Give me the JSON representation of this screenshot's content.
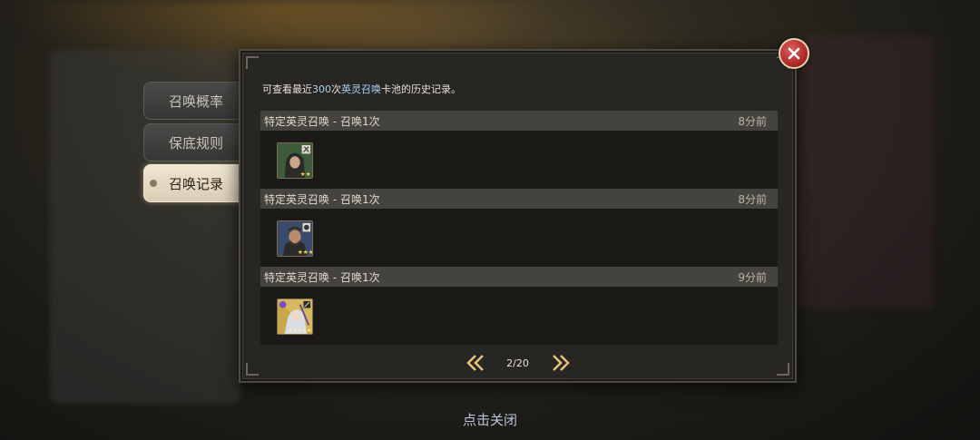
{
  "side_tabs": [
    {
      "label": "召唤概率",
      "active": false
    },
    {
      "label": "保底规则",
      "active": false
    },
    {
      "label": "召唤记录",
      "active": true
    }
  ],
  "description": {
    "prefix": "可查看最近",
    "count": "300",
    "middle": "次",
    "pool_name": "英灵召唤",
    "suffix": "卡池的历史记录。"
  },
  "records": [
    {
      "title": "特定英灵召唤 - 召唤1次",
      "time": "8分前",
      "hero_icon": "hooded-archer-portrait",
      "stars": 2
    },
    {
      "title": "特定英灵召唤 - 召唤1次",
      "time": "8分前",
      "hero_icon": "bearded-warrior-portrait",
      "stars": 3
    },
    {
      "title": "特定英灵召唤 - 召唤1次",
      "time": "9分前",
      "hero_icon": "silver-hair-mage-portrait",
      "stars": 5
    }
  ],
  "pagination": {
    "text": "2/20"
  },
  "close_hint": "点击关闭",
  "colors": {
    "highlight": "#a9d3f5",
    "close_button": "#b02a2a"
  }
}
